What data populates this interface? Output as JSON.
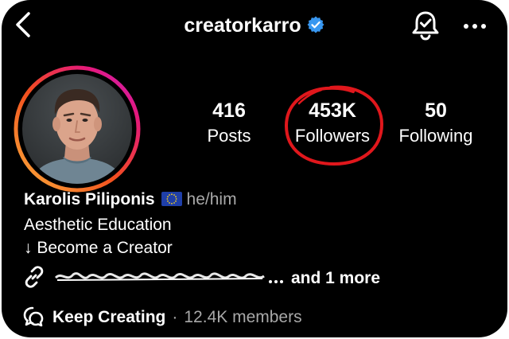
{
  "header": {
    "username": "creatorkarro",
    "verified": true,
    "icons": {
      "back": "chevron-left-icon",
      "verified": "verified-badge-icon",
      "notifications": "bell-check-icon",
      "more": "more-horizontal-icon"
    }
  },
  "profile": {
    "stats": {
      "posts": {
        "value": "416",
        "label": "Posts"
      },
      "followers": {
        "value": "453K",
        "label": "Followers"
      },
      "following": {
        "value": "50",
        "label": "Following"
      }
    },
    "name": "Karolis Piliponis",
    "flag": "eu-flag-icon",
    "pronouns": "he/him",
    "bio_lines": [
      "Aesthetic Education",
      "↓ Become a Creator"
    ],
    "links": {
      "icon": "link-icon",
      "more_text": "and 1 more"
    },
    "community": {
      "icon": "chat-bubble-icon",
      "name": "Keep Creating",
      "separator": "·",
      "members": "12.4K members"
    }
  },
  "colors": {
    "background": "#000000",
    "text": "#ffffff",
    "secondary_text": "#a8a8a8",
    "verified_blue": "#3897f0",
    "annotation_red": "#e0171c",
    "story_ring_start": "#f9a825",
    "story_ring_end": "#c026d3"
  }
}
